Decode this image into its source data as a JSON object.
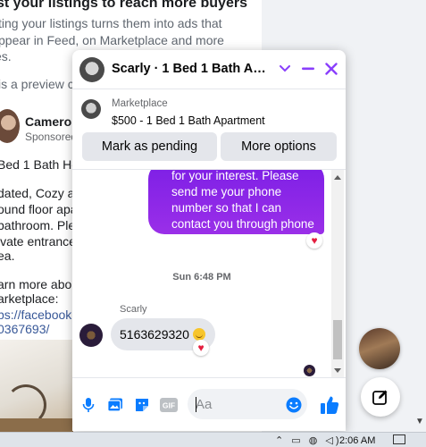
{
  "background_feed": {
    "headline": "st your listings to reach more buyers",
    "desc_lines": [
      "ting your listings turns them into ads that",
      "ppear in Feed, on Marketplace and more",
      "es."
    ],
    "preview_text": "is a preview c",
    "post_author": "Cameron",
    "post_sponsored": "Sponsored",
    "post_lines": [
      "Bed 1 Bath Ho",
      "dated, Cozy a",
      "ound floor apar",
      " bathroom. Ple",
      "ivate entrance",
      "ea.",
      "arn more abou",
      "arketplace:"
    ],
    "post_links": [
      "ps://facebook.",
      "0367693/"
    ]
  },
  "chat": {
    "title": "Scarly · 1 Bed 1 Bath Apart...",
    "listing": {
      "source": "Marketplace",
      "title": "$500 - 1 Bed 1 Bath Apartment",
      "pending_label": "Mark as pending",
      "more_label": "More options"
    },
    "messages": {
      "sent_text": "for your interest. Please send me your phone number so that I can contact you through phone",
      "sent_reaction": "♥",
      "timestamp": "Sun 6:48 PM",
      "sender_name": "Scarly",
      "received_text": "5163629320",
      "received_reaction": "♥"
    },
    "composer": {
      "placeholder": "Aa",
      "gif_label": "GIF"
    }
  },
  "taskbar": {
    "tray_icons": "⌃ ▭ ◍ ◁)",
    "time": "2:06 AM"
  },
  "colors": {
    "accent": "#8a3ffc",
    "sent_bubble": "#7d1fe6",
    "messenger_blue": "#0a7cff",
    "reaction": "#e41e3f"
  }
}
